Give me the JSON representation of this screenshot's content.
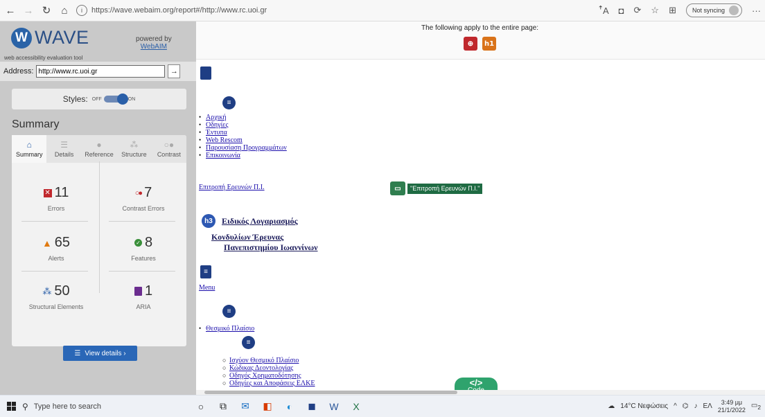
{
  "browser": {
    "url": "https://wave.webaim.org/report#/http://www.rc.uoi.gr",
    "sync_label": "Not syncing"
  },
  "wave": {
    "logo_text": "WAVE",
    "tagline": "web accessibility evaluation tool",
    "powered_by": "powered by",
    "powered_link": "WebAIM",
    "address_label": "Address:",
    "address_value": "http://www.rc.uoi.gr",
    "go_arrow": "→",
    "styles_label": "Styles:",
    "styles_off": "OFF",
    "styles_on": "ON",
    "summary_title": "Summary",
    "tabs": [
      {
        "label": "Summary",
        "icon": "home-icon"
      },
      {
        "label": "Details",
        "icon": "list-icon"
      },
      {
        "label": "Reference",
        "icon": "info-icon"
      },
      {
        "label": "Structure",
        "icon": "structure-icon"
      },
      {
        "label": "Contrast",
        "icon": "contrast-icon"
      }
    ],
    "stats": {
      "errors": {
        "value": "11",
        "label": "Errors"
      },
      "contrast": {
        "value": "7",
        "label": "Contrast Errors"
      },
      "alerts": {
        "value": "65",
        "label": "Alerts"
      },
      "features": {
        "value": "8",
        "label": "Features"
      },
      "structural": {
        "value": "50",
        "label": "Structural Elements"
      },
      "aria": {
        "value": "1",
        "label": "ARIA"
      }
    },
    "view_details": "View details ›"
  },
  "page": {
    "entire_page_text": "The following apply to the entire page:",
    "badge_h1": "h1",
    "nav_links_1": [
      "Αρχική",
      "Οδηγίες",
      "Έντυπα",
      "Web Rescom",
      "Παρουσίαση Προγραμμάτων",
      "Επικοινωνία"
    ],
    "img_alt_link": "Επιτροπή Ερευνών Π.Ι.",
    "green_tag": "\"Επιτροπή Ερευνών Π.Ι.\"",
    "h3_badge": "h3",
    "h3_title": "Ειδικός Λογαριασμός",
    "subtitle_1": "Κονδυλίων Έρευνας",
    "subtitle_2": "Πανεπιστημίου Ιωαννίνων",
    "menu_link": "Menu",
    "nav_links_2": [
      "Θεσμικό Πλαίσιο"
    ],
    "nav_links_3": [
      "Ισχύον Θεσμικό Πλαίσιο",
      "Κώδικας Δεοντολογίας",
      "Οδηγός Χρηματοδότησης",
      "Οδηγίες και Αποφάσεις ΕΛΚΕ"
    ],
    "code_tab": "Code"
  },
  "taskbar": {
    "search_placeholder": "Type here to search",
    "weather": "14°C Νεφώσεις",
    "lang": "ΕΛ",
    "time": "3:49 μμ",
    "date": "21/1/2022",
    "notifications": "2"
  }
}
